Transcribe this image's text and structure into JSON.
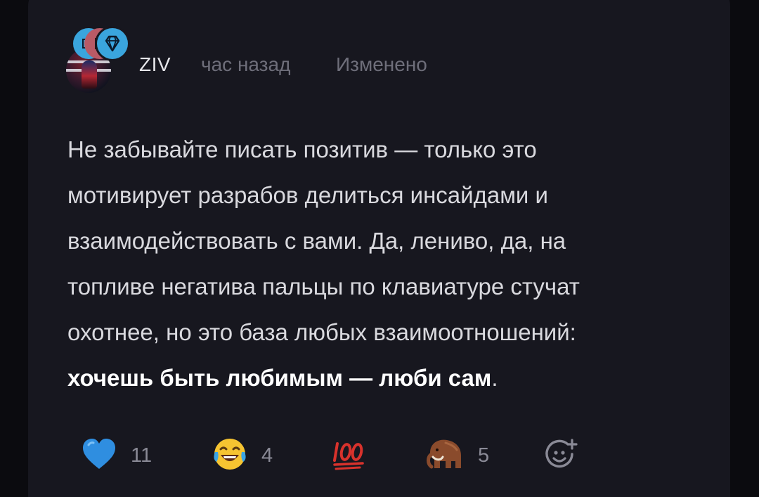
{
  "post": {
    "author": {
      "name": "ZIV"
    },
    "time": "час назад",
    "edited_label": "Изменено",
    "body_lines": [
      "Не забывайте писать позитив — только это",
      "мотивирует разрабов делиться инсайдами и",
      "взаимодействовать с вами. Да, лениво, да, на",
      "топливе негатива пальцы по клавиатуре стучат",
      "охотнее, но это база любых взаимоотношений:"
    ],
    "body_bold": "хочешь быть любимым — люби сам",
    "body_tail": "."
  },
  "reactions": [
    {
      "icon": "blue-heart-icon",
      "count": "11"
    },
    {
      "icon": "joy-face-icon",
      "count": "4"
    },
    {
      "icon": "hundred-points-icon",
      "count": ""
    },
    {
      "icon": "mammoth-icon",
      "count": "5"
    }
  ],
  "add_reaction_icon": "add-reaction-icon",
  "colors": {
    "background": "#0b0b0f",
    "card": "#17171f",
    "text": "#d9d9de",
    "muted": "#6e6e7a",
    "badge_blue": "#3aa5dd",
    "badge_red": "#b85a66",
    "heart": "#2f8ee0",
    "hundred_red": "#d8322c"
  }
}
